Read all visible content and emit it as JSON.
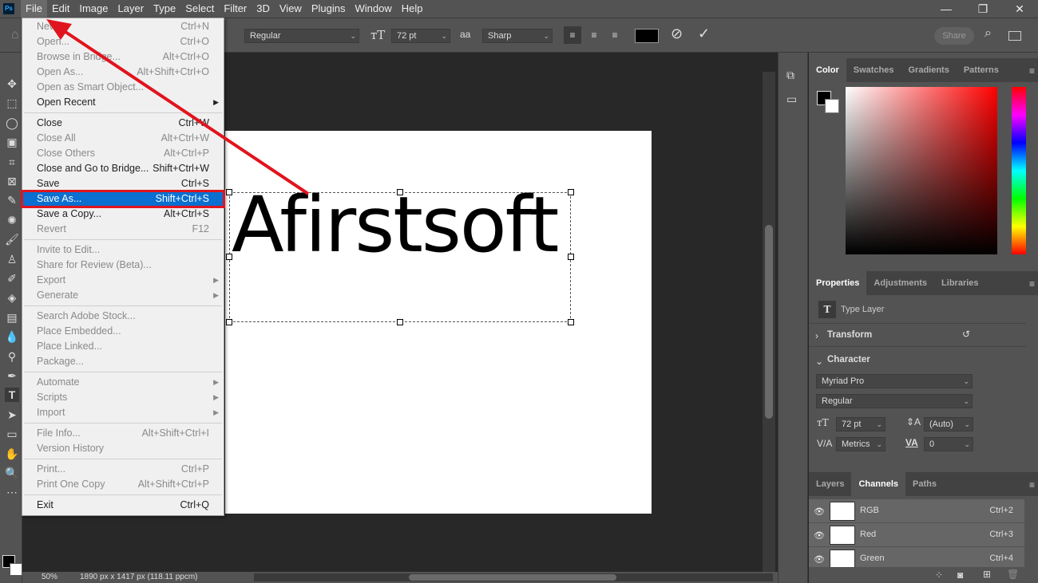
{
  "app": {
    "logo": "Ps"
  },
  "menubar": [
    "File",
    "Edit",
    "Image",
    "Layer",
    "Type",
    "Select",
    "Filter",
    "3D",
    "View",
    "Plugins",
    "Window",
    "Help"
  ],
  "window_controls": {
    "minimize": "—",
    "restore": "❐",
    "close": "✕"
  },
  "options": {
    "font_style": "Regular",
    "font_size": "72 pt",
    "antialias_label": "aa",
    "antialias": "Sharp",
    "share": "Share"
  },
  "file_menu": [
    {
      "label": "New...",
      "shortcut": "Ctrl+N",
      "enabled": false
    },
    {
      "label": "Open...",
      "shortcut": "Ctrl+O",
      "enabled": false
    },
    {
      "label": "Browse in Bridge...",
      "shortcut": "Alt+Ctrl+O",
      "enabled": false
    },
    {
      "label": "Open As...",
      "shortcut": "Alt+Shift+Ctrl+O",
      "enabled": false
    },
    {
      "label": "Open as Smart Object...",
      "shortcut": "",
      "enabled": false
    },
    {
      "label": "Open Recent",
      "shortcut": "",
      "enabled": true,
      "submenu": true
    },
    {
      "sep": true
    },
    {
      "label": "Close",
      "shortcut": "Ctrl+W",
      "enabled": true
    },
    {
      "label": "Close All",
      "shortcut": "Alt+Ctrl+W",
      "enabled": false
    },
    {
      "label": "Close Others",
      "shortcut": "Alt+Ctrl+P",
      "enabled": false
    },
    {
      "label": "Close and Go to Bridge...",
      "shortcut": "Shift+Ctrl+W",
      "enabled": true
    },
    {
      "label": "Save",
      "shortcut": "Ctrl+S",
      "enabled": true
    },
    {
      "label": "Save As...",
      "shortcut": "Shift+Ctrl+S",
      "enabled": true,
      "highlighted": true
    },
    {
      "label": "Save a Copy...",
      "shortcut": "Alt+Ctrl+S",
      "enabled": true
    },
    {
      "label": "Revert",
      "shortcut": "F12",
      "enabled": false
    },
    {
      "sep": true
    },
    {
      "label": "Invite to Edit...",
      "shortcut": "",
      "enabled": false
    },
    {
      "label": "Share for Review (Beta)...",
      "shortcut": "",
      "enabled": false
    },
    {
      "label": "Export",
      "shortcut": "",
      "enabled": false,
      "submenu": true
    },
    {
      "label": "Generate",
      "shortcut": "",
      "enabled": false,
      "submenu": true
    },
    {
      "sep": true
    },
    {
      "label": "Search Adobe Stock...",
      "shortcut": "",
      "enabled": false
    },
    {
      "label": "Place Embedded...",
      "shortcut": "",
      "enabled": false
    },
    {
      "label": "Place Linked...",
      "shortcut": "",
      "enabled": false
    },
    {
      "label": "Package...",
      "shortcut": "",
      "enabled": false
    },
    {
      "sep": true
    },
    {
      "label": "Automate",
      "shortcut": "",
      "enabled": false,
      "submenu": true
    },
    {
      "label": "Scripts",
      "shortcut": "",
      "enabled": false,
      "submenu": true
    },
    {
      "label": "Import",
      "shortcut": "",
      "enabled": false,
      "submenu": true
    },
    {
      "sep": true
    },
    {
      "label": "File Info...",
      "shortcut": "Alt+Shift+Ctrl+I",
      "enabled": false
    },
    {
      "label": "Version History",
      "shortcut": "",
      "enabled": false
    },
    {
      "sep": true
    },
    {
      "label": "Print...",
      "shortcut": "Ctrl+P",
      "enabled": false
    },
    {
      "label": "Print One Copy",
      "shortcut": "Alt+Shift+Ctrl+P",
      "enabled": false
    },
    {
      "sep": true
    },
    {
      "label": "Exit",
      "shortcut": "Ctrl+Q",
      "enabled": true
    }
  ],
  "canvas": {
    "text": "Afirstsoft"
  },
  "status": {
    "zoom": "50%",
    "doc_info": "1890 px x 1417 px (118.11 ppcm)"
  },
  "color_panel": {
    "tabs": [
      "Color",
      "Swatches",
      "Gradients",
      "Patterns"
    ],
    "active": 0
  },
  "properties_panel": {
    "tabs": [
      "Properties",
      "Adjustments",
      "Libraries"
    ],
    "layer_type": "Type Layer",
    "transform": "Transform",
    "character": "Character",
    "font": "Myriad Pro",
    "style": "Regular",
    "size": "72 pt",
    "leading": "(Auto)",
    "kerning": "Metrics",
    "tracking": "0"
  },
  "layers_panel": {
    "tabs": [
      "Layers",
      "Channels",
      "Paths"
    ],
    "active": 1,
    "channels": [
      {
        "name": "RGB",
        "shortcut": "Ctrl+2"
      },
      {
        "name": "Red",
        "shortcut": "Ctrl+3"
      },
      {
        "name": "Green",
        "shortcut": "Ctrl+4"
      }
    ]
  },
  "colors": {
    "highlight": "#0a6fd0",
    "annotation": "#e0141e"
  }
}
